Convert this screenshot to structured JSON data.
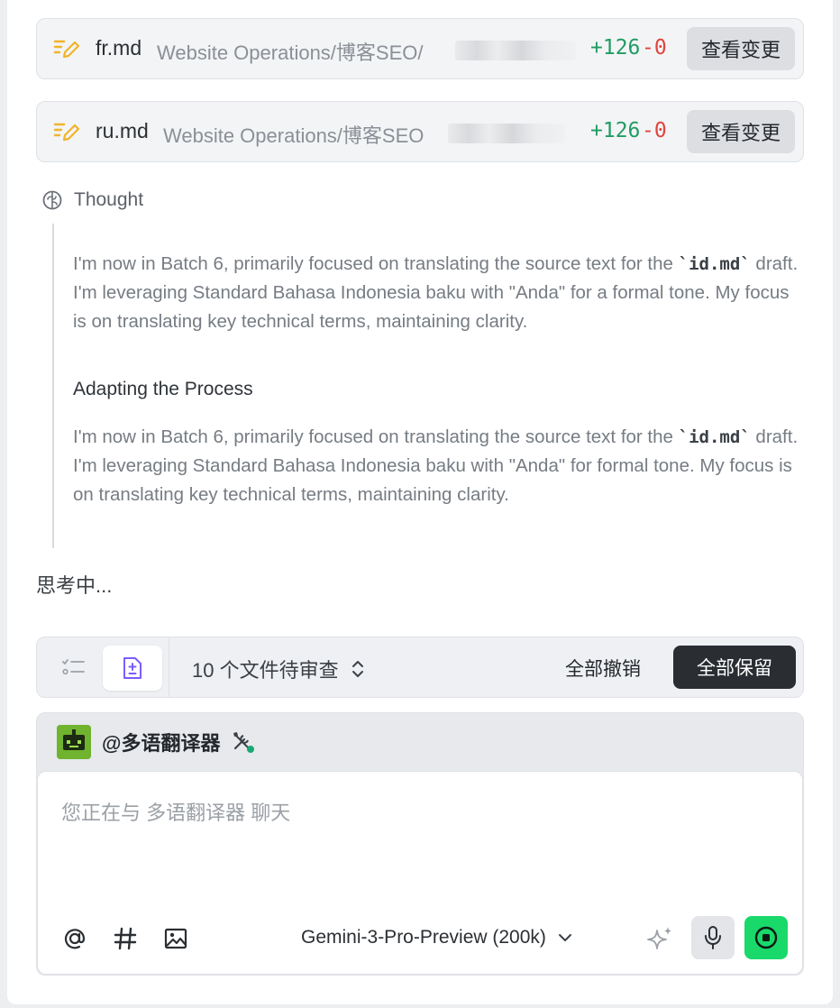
{
  "files": [
    {
      "name": "fr.md",
      "path": "Website Operations/博客SEO/",
      "added": "+126",
      "removed": "-0",
      "action": "查看变更"
    },
    {
      "name": "ru.md",
      "path": "Website Operations/博客SEO",
      "added": "+126",
      "removed": "-0",
      "action": "查看变更"
    }
  ],
  "thought": {
    "label": "Thought",
    "para1_pre": "I'm now in Batch 6, primarily focused on translating the source text for the",
    "para1_code": "`id.md`",
    "para1_post": "draft. I'm leveraging Standard Bahasa Indonesia baku with \"Anda\" for a formal tone. My focus is on translating key technical terms, maintaining clarity.",
    "subheading": "Adapting the Process",
    "para2_pre": "I'm now in Batch 6, primarily focused on translating the source text for the",
    "para2_code": "`id.md`",
    "para2_post": "draft. I'm leveraging Standard Bahasa Indonesia baku with \"Anda\" for formal tone. My focus is on translating key technical terms, maintaining clarity."
  },
  "status": {
    "thinking": "思考中..."
  },
  "review": {
    "pending_label": "10 个文件待审查",
    "undo_all": "全部撤销",
    "keep_all": "全部保留"
  },
  "composer": {
    "agent_name": "@多语翻译器",
    "placeholder": "您正在与 多语翻译器 聊天",
    "model": "Gemini-3-Pro-Preview (200k)"
  },
  "colors": {
    "added": "#1f9c62",
    "removed": "#e0443c",
    "send": "#19d96b",
    "edit_icon": "#f0b429",
    "diff_icon": "#7c5cff"
  },
  "icons": [
    "edit-icon",
    "brain-icon",
    "checklist-icon",
    "file-diff-icon",
    "sort-icon",
    "robot-avatar",
    "tools-icon",
    "at-icon",
    "hash-icon",
    "image-icon",
    "chevron-down-icon",
    "sparkle-icon",
    "mic-icon",
    "stop-icon"
  ]
}
